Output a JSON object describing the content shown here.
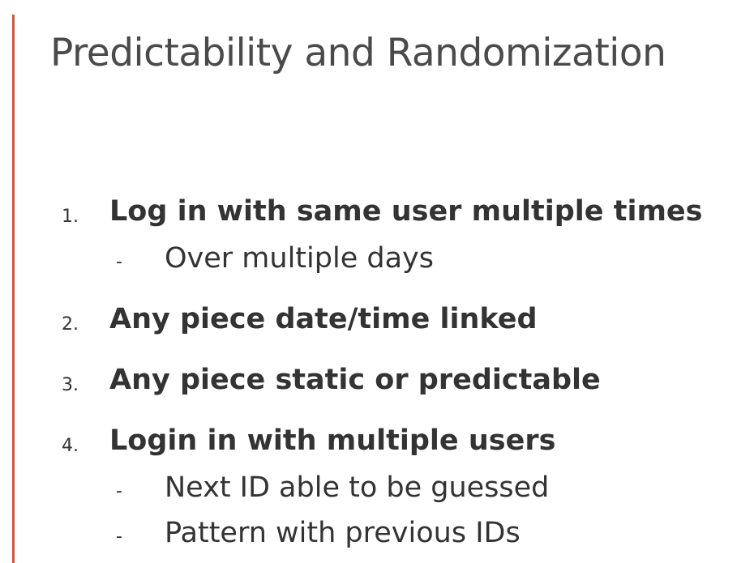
{
  "slide": {
    "title": "Predictability and Randomization",
    "accent_color": "#d9553b",
    "items": [
      {
        "number": "1.",
        "text": "Log in with same user multiple times",
        "subitems": [
          {
            "bullet": "-",
            "text": "Over multiple days"
          }
        ]
      },
      {
        "number": "2.",
        "text": "Any piece date/time linked",
        "subitems": []
      },
      {
        "number": "3.",
        "text": "Any piece static or predictable",
        "subitems": []
      },
      {
        "number": "4.",
        "text": "Login in with multiple users",
        "subitems": [
          {
            "bullet": "-",
            "text": "Next ID able to be guessed"
          },
          {
            "bullet": "-",
            "text": "Pattern with previous IDs"
          }
        ]
      }
    ]
  }
}
